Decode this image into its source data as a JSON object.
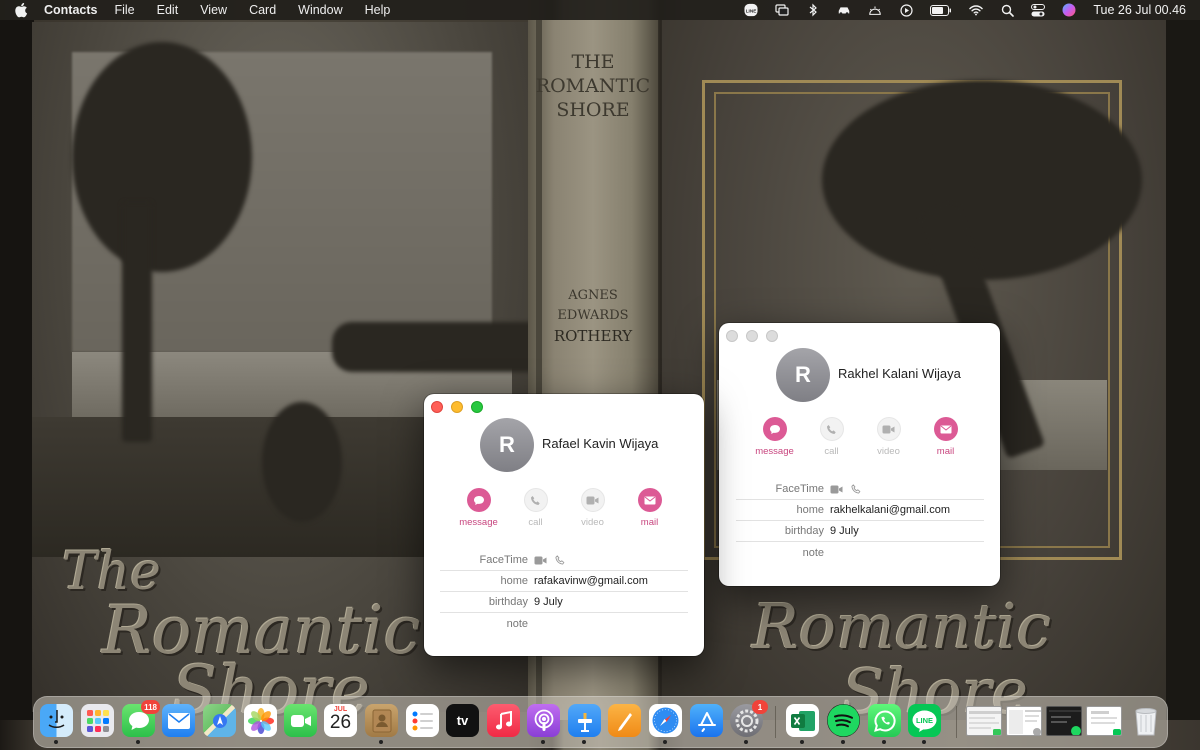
{
  "menubar": {
    "app_name": "Contacts",
    "menus": [
      "File",
      "Edit",
      "View",
      "Card",
      "Window",
      "Help"
    ],
    "clock": "Tue 26 Jul  00.46",
    "status_icons": [
      "line-icon",
      "screen-mirroring-icon",
      "bluetooth-icon",
      "car-icon",
      "brightness-icon",
      "play-icon",
      "battery-icon",
      "wifi-icon",
      "spotlight-search-icon",
      "control-center-icon",
      "siri-icon"
    ]
  },
  "wallpaper": {
    "spine_title": [
      "THE",
      "ROMANTIC",
      "SHORE"
    ],
    "spine_author": [
      "AGNES",
      "EDWARDS",
      "ROTHERY"
    ],
    "cover_left_title": [
      "The",
      "Romantic",
      "Shore"
    ],
    "cover_right_title": [
      "Romantic",
      "Shore"
    ]
  },
  "contact_front": {
    "initial": "R",
    "name": "Rafael Kavin Wijaya",
    "actions": [
      {
        "label": "message",
        "icon": "message-icon",
        "enabled": true
      },
      {
        "label": "call",
        "icon": "phone-icon",
        "enabled": false
      },
      {
        "label": "video",
        "icon": "video-icon",
        "enabled": false
      },
      {
        "label": "mail",
        "icon": "mail-icon",
        "enabled": true
      }
    ],
    "fields": {
      "facetime_label": "FaceTime",
      "home_label": "home",
      "home_value": "rafakavinw@gmail.com",
      "birthday_label": "birthday",
      "birthday_value": "9 July",
      "note_label": "note"
    }
  },
  "contact_back": {
    "initial": "R",
    "name": "Rakhel Kalani Wijaya",
    "actions": [
      {
        "label": "message",
        "icon": "message-icon",
        "enabled": true
      },
      {
        "label": "call",
        "icon": "phone-icon",
        "enabled": false
      },
      {
        "label": "video",
        "icon": "video-icon",
        "enabled": false
      },
      {
        "label": "mail",
        "icon": "mail-icon",
        "enabled": true
      }
    ],
    "fields": {
      "facetime_label": "FaceTime",
      "home_label": "home",
      "home_value": "rakhelkalani@gmail.com",
      "birthday_label": "birthday",
      "birthday_value": "9 July",
      "note_label": "note"
    }
  },
  "dock": {
    "apps": [
      {
        "name": "Finder",
        "icon": "finder-icon",
        "color": "#3c9ef5",
        "running": true
      },
      {
        "name": "Launchpad",
        "icon": "launchpad-icon",
        "color": "#e8e8e8",
        "running": false
      },
      {
        "name": "Messages",
        "icon": "messages-icon",
        "color": "#34c759",
        "running": true,
        "badge": "118"
      },
      {
        "name": "Mail",
        "icon": "mail-app-icon",
        "color": "#3b8ff0",
        "running": false
      },
      {
        "name": "Maps",
        "icon": "maps-icon",
        "color": "#5cc266",
        "running": false
      },
      {
        "name": "Photos",
        "icon": "photos-icon",
        "color": "#ffffff",
        "running": false
      },
      {
        "name": "FaceTime",
        "icon": "facetime-icon",
        "color": "#34c759",
        "running": false
      },
      {
        "name": "Calendar",
        "icon": "calendar-icon",
        "color": "#ffffff",
        "running": false,
        "month": "JUL",
        "day": "26"
      },
      {
        "name": "Contacts",
        "icon": "contacts-icon",
        "color": "#b8935f",
        "running": true
      },
      {
        "name": "Reminders",
        "icon": "reminders-icon",
        "color": "#ffffff",
        "running": false
      },
      {
        "name": "TV",
        "icon": "apple-tv-icon",
        "color": "#111111",
        "running": false,
        "text": "tv"
      },
      {
        "name": "Music",
        "icon": "music-icon",
        "color": "#fa3d4f",
        "running": false
      },
      {
        "name": "Podcasts",
        "icon": "podcasts-icon",
        "color": "#9d4fe0",
        "running": true
      },
      {
        "name": "Keynote",
        "icon": "keynote-icon",
        "color": "#2e8ff2",
        "running": true
      },
      {
        "name": "Pages",
        "icon": "pages-icon",
        "color": "#f59a23",
        "running": false
      },
      {
        "name": "Safari",
        "icon": "safari-icon",
        "color": "#2f8cf2",
        "running": true
      },
      {
        "name": "App Store",
        "icon": "app-store-icon",
        "color": "#2a7ff0",
        "running": false
      },
      {
        "name": "System Preferences",
        "icon": "system-preferences-icon",
        "color": "#8e8e93",
        "running": true,
        "badge": "1"
      },
      {
        "name": "Excel",
        "icon": "excel-icon",
        "color": "#1f7a45",
        "running": true
      },
      {
        "name": "Spotify",
        "icon": "spotify-icon",
        "color": "#1ed760",
        "running": true
      },
      {
        "name": "WhatsApp",
        "icon": "whatsapp-icon",
        "color": "#25d366",
        "running": true
      },
      {
        "name": "LINE",
        "icon": "line-app-icon",
        "color": "#06c755",
        "running": true,
        "text": "LINE"
      }
    ],
    "minimized": [
      {
        "name": "minimized-window-1",
        "icon": "minimized-window-icon"
      },
      {
        "name": "minimized-window-2",
        "icon": "minimized-window-icon"
      },
      {
        "name": "minimized-window-3",
        "icon": "minimized-window-icon"
      },
      {
        "name": "minimized-window-4",
        "icon": "minimized-window-icon"
      }
    ],
    "trash": {
      "name": "Trash",
      "icon": "trash-icon"
    }
  }
}
